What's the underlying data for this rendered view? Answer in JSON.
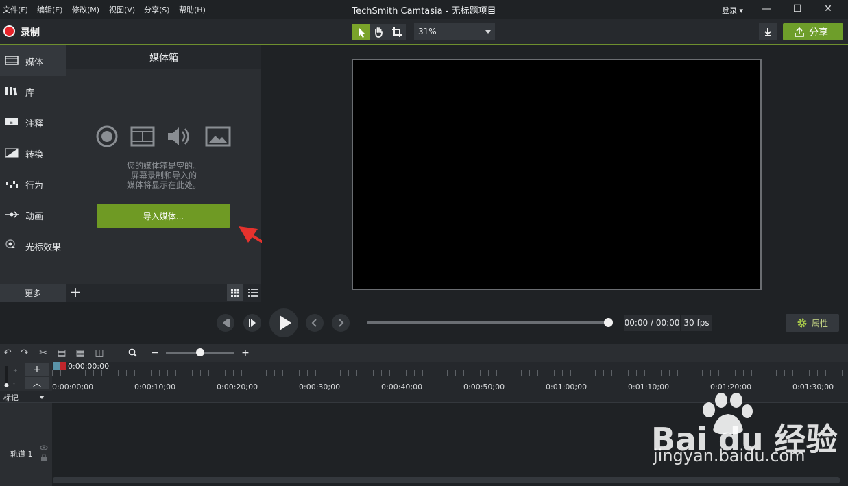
{
  "menu": [
    "文件(F)",
    "编辑(E)",
    "修改(M)",
    "视图(V)",
    "分享(S)",
    "帮助(H)"
  ],
  "app_title": "TechSmith Camtasia - 无标题项目",
  "login": "登录",
  "toolbar": {
    "record_label": "录制",
    "zoom_value": "31%",
    "share_label": "分享"
  },
  "sidebar": {
    "items": [
      {
        "label": "媒体",
        "icon": "media-icon"
      },
      {
        "label": "库",
        "icon": "library-icon"
      },
      {
        "label": "注释",
        "icon": "annotation-icon"
      },
      {
        "label": "转换",
        "icon": "transition-icon"
      },
      {
        "label": "行为",
        "icon": "behavior-icon"
      },
      {
        "label": "动画",
        "icon": "animation-icon"
      },
      {
        "label": "光标效果",
        "icon": "cursor-effect-icon"
      }
    ],
    "more_label": "更多"
  },
  "media_bin": {
    "title": "媒体箱",
    "empty_line1": "您的媒体箱是空的。",
    "empty_line2": "屏幕录制和导入的",
    "empty_line3": "媒体将显示在此处。",
    "import_button": "导入媒体..."
  },
  "playback": {
    "timecode": "00:00 / 00:00",
    "fps": "30 fps",
    "properties_label": "属性"
  },
  "timeline": {
    "playhead_time": "0:00:00;00",
    "ruler": [
      "0:00:00;00",
      "0:00:10;00",
      "0:00:20;00",
      "0:00:30;00",
      "0:00:40;00",
      "0:00:50;00",
      "0:01:00;00",
      "0:01:10;00",
      "0:01:20;00",
      "0:01:30;00"
    ],
    "marker_label": "标记",
    "track1_label": "轨道 1"
  },
  "watermark": {
    "text": "Bai du 经验",
    "url": "jingyan.baidu.com"
  },
  "colors": {
    "accent_green": "#6f9a24",
    "record_red": "#e8242a"
  }
}
